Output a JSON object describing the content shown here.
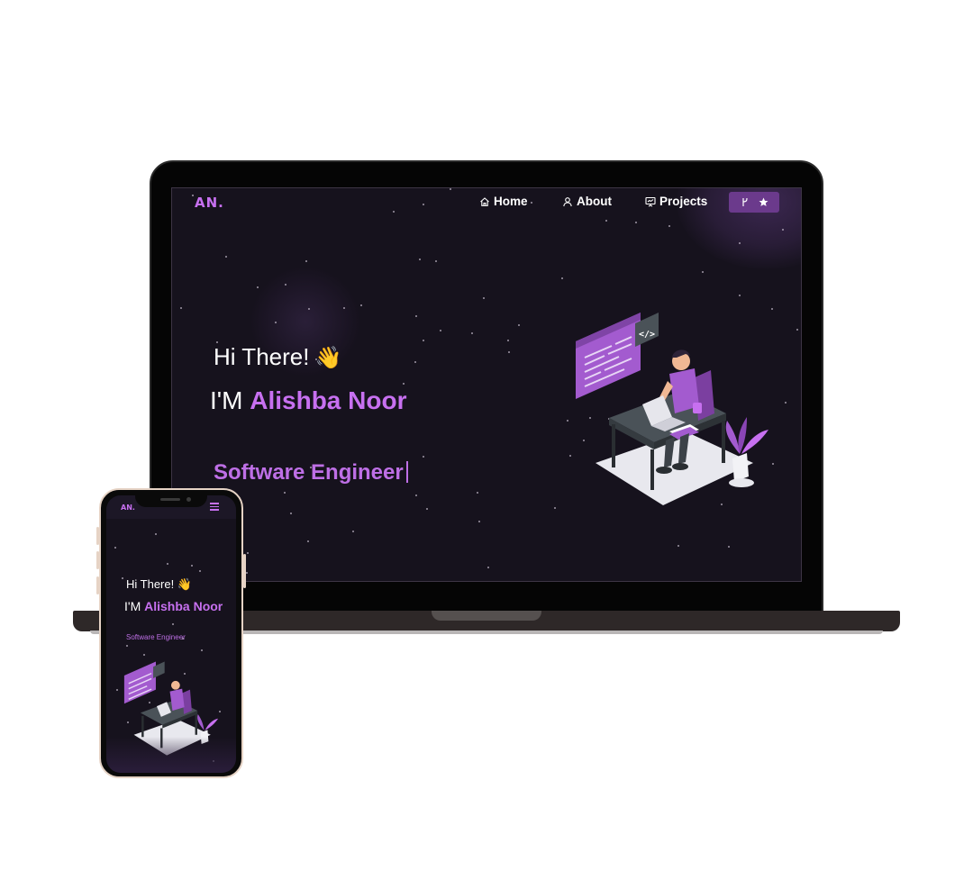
{
  "desktop": {
    "logo": "AN.",
    "nav": {
      "home": "Home",
      "about": "About",
      "projects": "Projects"
    },
    "hero": {
      "greeting": "Hi There!",
      "wave": "👋",
      "intro_prefix": "I'M",
      "name": "Alishba Noor",
      "role": "Software Engineer"
    }
  },
  "mobile": {
    "logo": "AN.",
    "hero": {
      "greeting": "Hi There!",
      "wave": "👋",
      "intro_prefix": "I'M",
      "name": "Alishba Noor",
      "role": "Software Engineer"
    }
  },
  "colors": {
    "accent": "#c770f0",
    "background": "#16121d",
    "fork_button": "#6b3a8c"
  },
  "icons": {
    "home": "home-icon",
    "about": "user-icon",
    "projects": "presentation-icon",
    "fork": "git-fork-icon",
    "star": "star-icon",
    "menu": "hamburger-menu-icon"
  }
}
